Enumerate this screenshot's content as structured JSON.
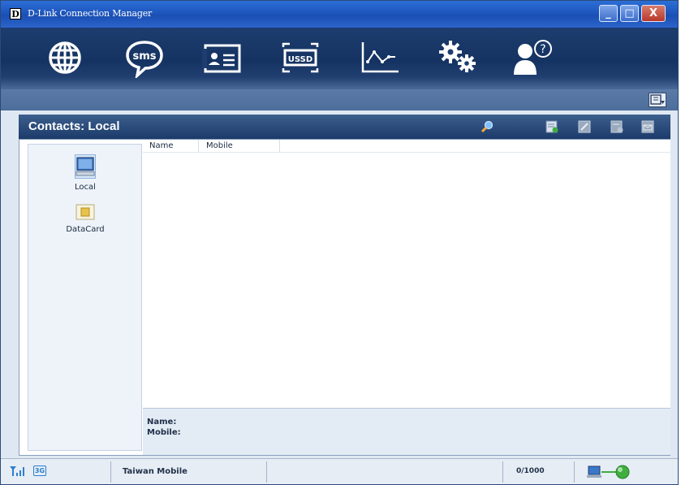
{
  "window": {
    "logo_letter": "D",
    "title": "D-Link Connection Manager",
    "minimize": "_",
    "maximize": "□",
    "close": "X"
  },
  "toolbar": {
    "items": [
      {
        "icon": "globe-icon",
        "label": "Internet"
      },
      {
        "icon": "sms-icon",
        "label": "sms"
      },
      {
        "icon": "contacts-icon",
        "label": "Contacts"
      },
      {
        "icon": "ussd-icon",
        "label": "USSD"
      },
      {
        "icon": "statistics-icon",
        "label": "Statistics"
      },
      {
        "icon": "settings-icon",
        "label": "Settings"
      },
      {
        "icon": "help-icon",
        "label": "Help"
      }
    ]
  },
  "panel": {
    "title": "Contacts: Local",
    "buttons": [
      "search-icon",
      "new-contact-icon",
      "edit-contact-icon",
      "delete-contact-icon",
      "send-message-icon"
    ]
  },
  "tree": {
    "items": [
      {
        "label": "Local",
        "icon": "computer-icon"
      },
      {
        "label": "DataCard",
        "icon": "sim-card-icon"
      }
    ]
  },
  "list": {
    "columns": [
      "Name",
      "Mobile"
    ],
    "rows": []
  },
  "detail": {
    "name_label": "Name:",
    "mobile_label": "Mobile:"
  },
  "status": {
    "network_type": "3G",
    "carrier": "Taiwan Mobile",
    "sms_count": "0/1000"
  },
  "colors": {
    "titlebar": "#1e56bd",
    "toolbar": "#153362",
    "panel_header": "#1c3b6a"
  }
}
